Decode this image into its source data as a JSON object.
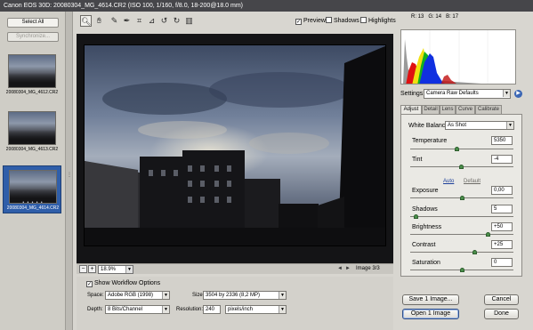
{
  "window": {
    "title": "Canon EOS 30D: 20080304_MG_4614.CR2  (ISO 100, 1/160, f/8.0, 18-200@18.0 mm)"
  },
  "filmstrip": {
    "select_all": "Select All",
    "synchronize": "Synchronize...",
    "items": [
      {
        "caption": "20080304_MG_4612.CR2"
      },
      {
        "caption": "20080304_MG_4613.CR2"
      },
      {
        "caption": "20080304_MG_4614.CR2",
        "rating": "• • • • •"
      }
    ]
  },
  "toolbar": {
    "tools": [
      "zoom-icon",
      "hand-icon",
      "white-balance-icon",
      "color-sampler-icon",
      "crop-icon",
      "straighten-icon",
      "rotate-left-icon",
      "rotate-right-icon",
      "trash-icon"
    ],
    "preview": {
      "label": "Preview",
      "checked": true
    },
    "shadows": {
      "label": "Shadows",
      "checked": false
    },
    "highlights": {
      "label": "Highlights",
      "checked": false
    }
  },
  "zoom": {
    "minus": "−",
    "plus": "+",
    "value": "18.9%",
    "prev_icon": "◄",
    "next_icon": "►",
    "image_count": "Image 3/3"
  },
  "workflow": {
    "show_label": "Show Workflow Options",
    "space_label": "Space:",
    "space_value": "Adobe RGB (1998)",
    "depth_label": "Depth:",
    "depth_value": "8 Bits/Channel",
    "size_label": "Size:",
    "size_value": "3504 by 2336  (8,2 MP)",
    "resolution_label": "Resolution:",
    "resolution_value": "240",
    "resolution_unit": "pixels/inch"
  },
  "readout": {
    "r": "R:  13",
    "g": "G:  14",
    "b": "B:  17"
  },
  "settings": {
    "label": "Settings:",
    "value": "Camera Raw Defaults"
  },
  "tabs": [
    "Adjust",
    "Detail",
    "Lens",
    "Curve",
    "Calibrate"
  ],
  "adjust": {
    "white_balance_label": "White Balance:",
    "white_balance_value": "As Shot",
    "temperature": {
      "label": "Temperature",
      "value": "5350",
      "position": 0.45
    },
    "tint": {
      "label": "Tint",
      "value": "-4",
      "position": 0.49
    },
    "auto": "Auto",
    "default": "Default",
    "exposure": {
      "label": "Exposure",
      "value": "0,00",
      "position": 0.5
    },
    "shadows": {
      "label": "Shadows",
      "value": "5",
      "position": 0.05
    },
    "brightness": {
      "label": "Brightness",
      "value": "+50",
      "position": 0.75
    },
    "contrast": {
      "label": "Contrast",
      "value": "+25",
      "position": 0.62
    },
    "saturation": {
      "label": "Saturation",
      "value": "0",
      "position": 0.5
    }
  },
  "buttons": {
    "save": "Save 1 Image...",
    "cancel": "Cancel",
    "open": "Open 1 Image",
    "done": "Done"
  }
}
